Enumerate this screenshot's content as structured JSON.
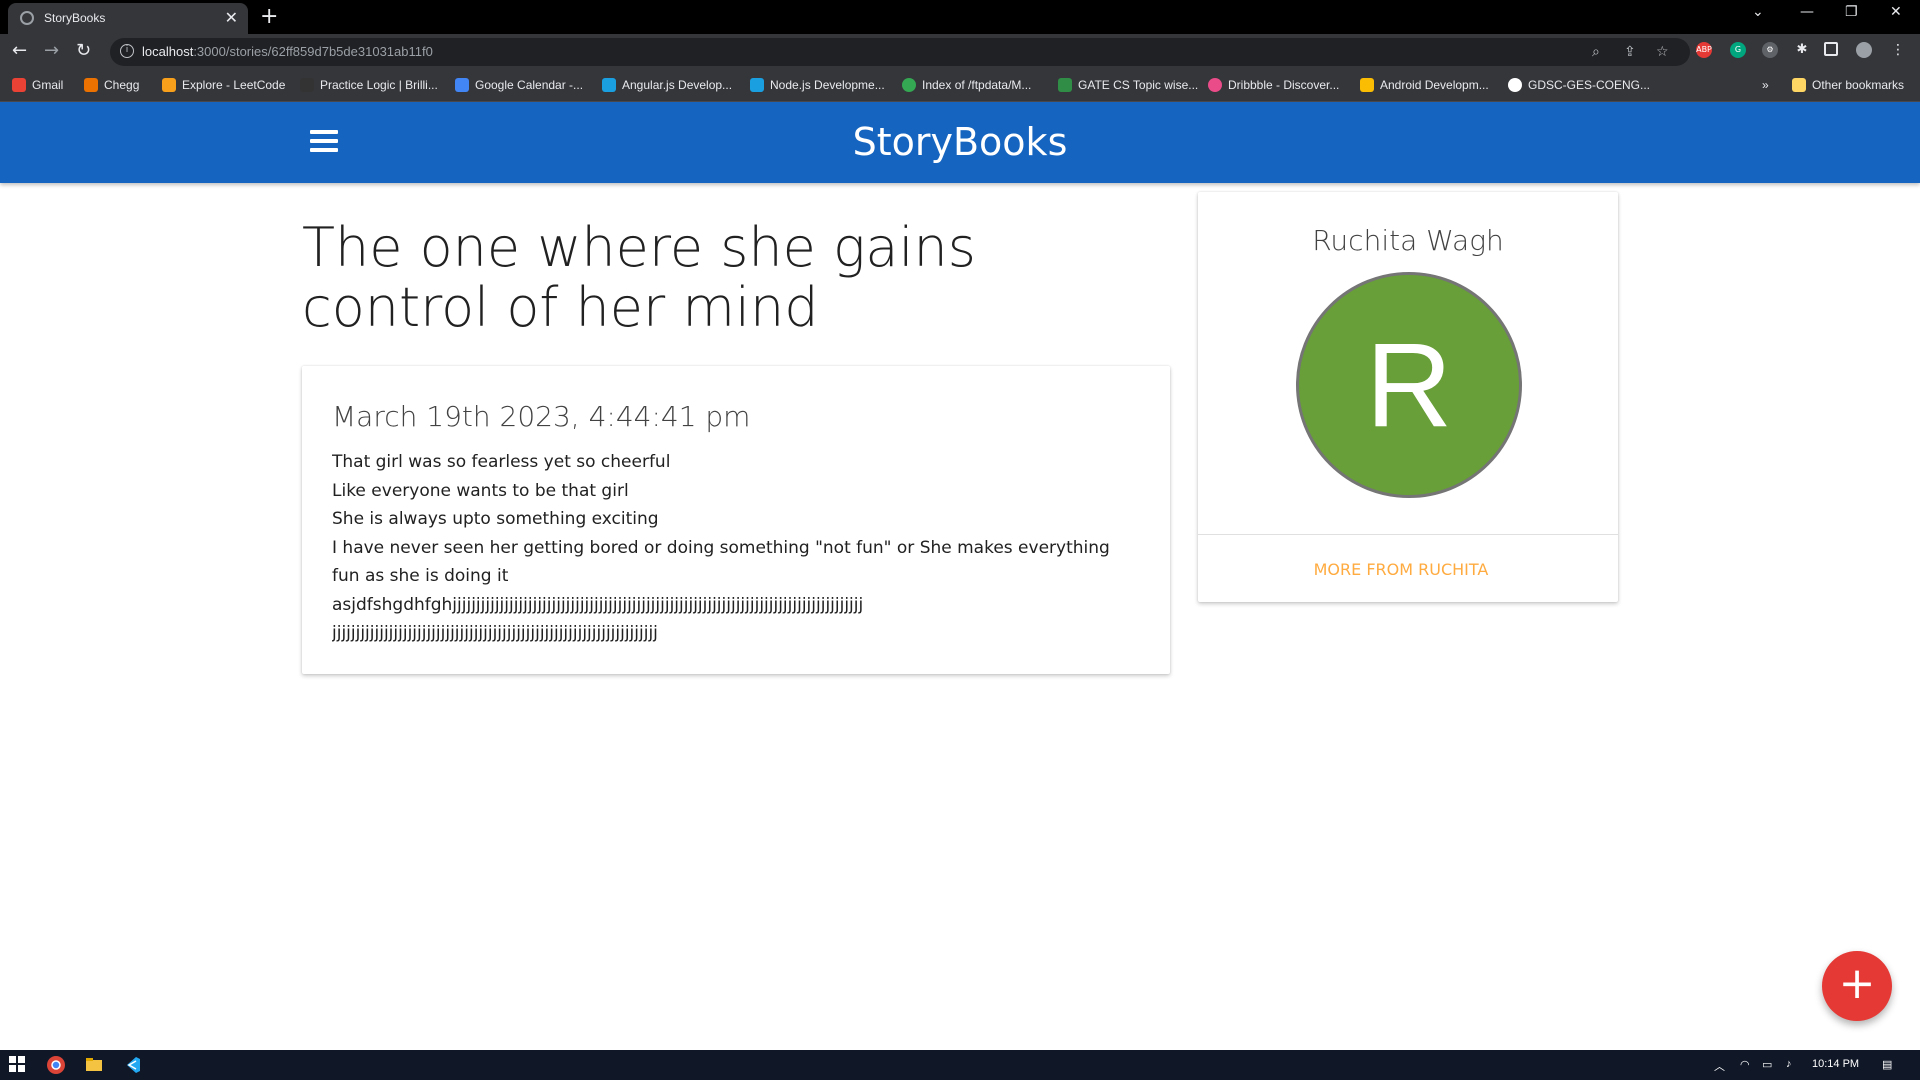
{
  "browser": {
    "tab_title": "StoryBooks",
    "tab_close": "✕",
    "new_tab": "+",
    "url_host": "localhost",
    "url_path": ":3000/stories/62ff859d7b5de31031ab11f0",
    "bookmarks": [
      {
        "label": "Gmail",
        "color": "#ea4335"
      },
      {
        "label": "Chegg",
        "color": "#eb7100"
      },
      {
        "label": "Explore - LeetCode",
        "color": "#f89f1b"
      },
      {
        "label": "Practice Logic | Brilli...",
        "color": "#333333"
      },
      {
        "label": "Google Calendar -...",
        "color": "#4285f4"
      },
      {
        "label": "Angular.js Develop...",
        "color": "#1a9fe0"
      },
      {
        "label": "Node.js Developme...",
        "color": "#1a9fe0"
      },
      {
        "label": "Index of /ftpdata/M...",
        "color": "#34a853"
      },
      {
        "label": "GATE CS Topic wise...",
        "color": "#2f8d46"
      },
      {
        "label": "Dribbble - Discover...",
        "color": "#ea4c89"
      },
      {
        "label": "Android Developm...",
        "color": "#fbbc04"
      },
      {
        "label": "GDSC-GES-COENG...",
        "color": "#ffffff"
      }
    ],
    "other_bookmarks": "Other bookmarks",
    "more_bookmarks": "»"
  },
  "header": {
    "brand": "StoryBooks"
  },
  "story": {
    "title": "The one where she gains control of her mind",
    "date": "March 19th 2023, 4:44:41 pm",
    "lines": [
      "That girl was so fearless yet so cheerful",
      "Like everyone wants to be that girl",
      "She is always upto something exciting",
      "I have never seen her getting bored or doing something \"not fun\" or She makes everything fun as she is doing it",
      "asjdfshgdhfghjjjjjjjjjjjjjjjjjjjjjjjjjjjjjjjjjjjjjjjjjjjjjjjjjjjjjjjjjjjjjjjjjjjjjjjjjjjjjjjjjjjjjjj",
      "jjjjjjjjjjjjjjjjjjjjjjjjjjjjjjjjjjjjjjjjjjjjjjjjjjjjjjjjjjjjjjjjjjjjj"
    ]
  },
  "author": {
    "name": "Ruchita Wagh",
    "initial": "R",
    "more_link": "MORE FROM RUCHITA"
  },
  "fab": {
    "label": "+"
  },
  "taskbar": {
    "time": "10:14 PM"
  },
  "colors": {
    "header": "#1565c0",
    "avatar": "#689f38",
    "link": "#ffab40",
    "fab": "#e53935"
  }
}
